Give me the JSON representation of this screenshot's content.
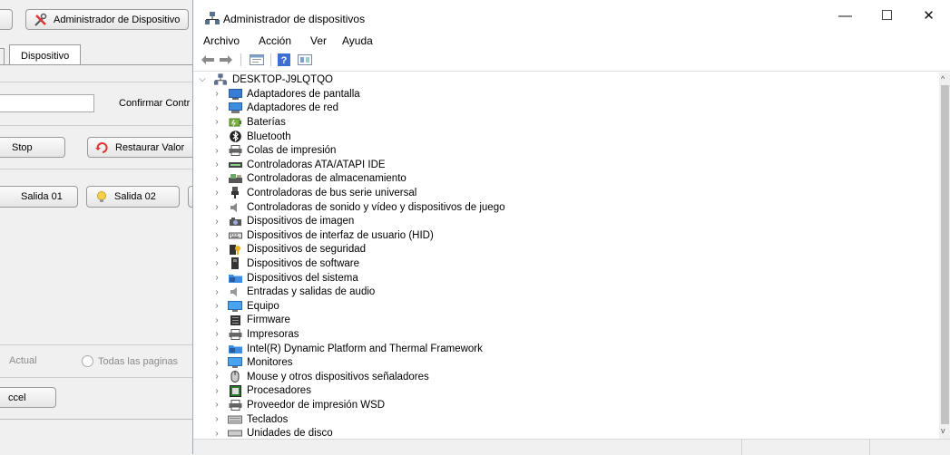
{
  "background_app": {
    "toolbar_button": "Administrador de Dispositivo",
    "tab": "Dispositivo",
    "confirm_label": "Confirmar Contr",
    "stop_button": "Stop",
    "restore_button": "Restaurar Valor",
    "output1_button": "Salida 01",
    "output2_button": "Salida 02",
    "radio_actual": "Actual",
    "radio_all_pages": "Todas las paginas",
    "excel_button": "ccel"
  },
  "window": {
    "title": "Administrador de dispositivos",
    "minimize": "—",
    "maximize": "☐",
    "close": "✕"
  },
  "menu": [
    "Archivo",
    "Acción",
    "Ver",
    "Ayuda"
  ],
  "toolbar_icons": [
    "back-arrow-icon",
    "forward-arrow-icon",
    "properties-icon",
    "help-icon",
    "show-hidden-icon"
  ],
  "tree": {
    "root": "DESKTOP-J9LQTQO",
    "items": [
      {
        "label": "Adaptadores de pantalla",
        "icon": "display-adapter-icon"
      },
      {
        "label": "Adaptadores de red",
        "icon": "network-adapter-icon"
      },
      {
        "label": "Baterías",
        "icon": "battery-icon"
      },
      {
        "label": "Bluetooth",
        "icon": "bluetooth-icon"
      },
      {
        "label": "Colas de impresión",
        "icon": "print-queue-icon"
      },
      {
        "label": "Controladoras ATA/ATAPI IDE",
        "icon": "ide-controller-icon"
      },
      {
        "label": "Controladoras de almacenamiento",
        "icon": "storage-controller-icon"
      },
      {
        "label": "Controladoras de bus serie universal",
        "icon": "usb-icon"
      },
      {
        "label": "Controladoras de sonido y vídeo y dispositivos de juego",
        "icon": "speaker-icon"
      },
      {
        "label": "Dispositivos de imagen",
        "icon": "camera-icon"
      },
      {
        "label": "Dispositivos de interfaz de usuario (HID)",
        "icon": "hid-icon"
      },
      {
        "label": "Dispositivos de seguridad",
        "icon": "security-key-icon"
      },
      {
        "label": "Dispositivos de software",
        "icon": "software-device-icon"
      },
      {
        "label": "Dispositivos del sistema",
        "icon": "system-folder-icon"
      },
      {
        "label": "Entradas y salidas de audio",
        "icon": "audio-icon"
      },
      {
        "label": "Equipo",
        "icon": "computer-icon"
      },
      {
        "label": "Firmware",
        "icon": "firmware-icon"
      },
      {
        "label": "Impresoras",
        "icon": "printer-icon"
      },
      {
        "label": "Intel(R) Dynamic Platform and Thermal Framework",
        "icon": "system-folder-icon"
      },
      {
        "label": "Monitores",
        "icon": "monitor-icon"
      },
      {
        "label": "Mouse y otros dispositivos señaladores",
        "icon": "mouse-icon"
      },
      {
        "label": "Procesadores",
        "icon": "processor-icon"
      },
      {
        "label": "Proveedor de impresión WSD",
        "icon": "printer-icon"
      },
      {
        "label": "Teclados",
        "icon": "keyboard-icon"
      },
      {
        "label": "Unidades de disco",
        "icon": "disk-drive-icon"
      }
    ]
  },
  "colors": {
    "accent_blue": "#3d8ee0",
    "window_bg": "#ffffff",
    "chrome_bg": "#f0f0f0"
  }
}
